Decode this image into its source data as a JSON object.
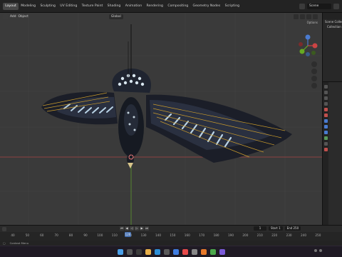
{
  "topbar": {
    "workspaces": [
      "Layout",
      "Modeling",
      "Sculpting",
      "UV Editing",
      "Texture Paint",
      "Shading",
      "Animation",
      "Rendering",
      "Compositing",
      "Geometry Nodes",
      "Scripting"
    ],
    "active_workspace": "Layout",
    "scene_label": "Scene"
  },
  "viewport": {
    "mode_label": "Add",
    "object_label": "Object",
    "transform_orientation": "Global",
    "options_label": "Options"
  },
  "outliner": {
    "items": [
      "Scene Collection",
      "Collection"
    ]
  },
  "timeline": {
    "current_frame": "120",
    "ruler_ticks": [
      "40",
      "50",
      "60",
      "70",
      "80",
      "90",
      "100",
      "110",
      "120",
      "130",
      "140",
      "150",
      "160",
      "170",
      "180",
      "190",
      "200",
      "210",
      "220",
      "230",
      "240",
      "250"
    ],
    "frame_fields": {
      "current": "1",
      "start_label": "Start",
      "start": "1",
      "end_label": "End",
      "end": "250"
    }
  },
  "statusbar": {
    "text": "Context Menu"
  },
  "colors": {
    "viewport_bg": "#3a3a3a",
    "accent_blue": "#4772b3",
    "axis_red": "#c44",
    "axis_green": "#6a2"
  }
}
